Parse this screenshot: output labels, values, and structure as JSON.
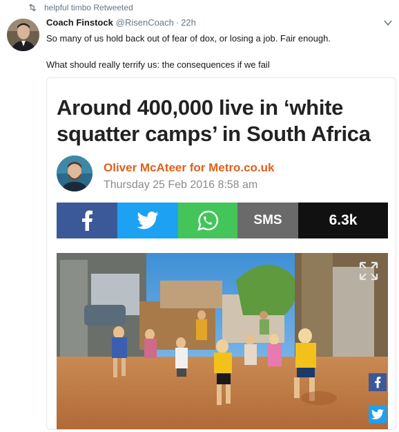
{
  "retweet": {
    "text": "helpful timbo Retweeted"
  },
  "tweet": {
    "name": "Coach Finstock",
    "handle": "@RisenCoach",
    "separator": "·",
    "time": "22h",
    "text": "So many of us hold back out of fear of dox, or losing a job. Fair enough.\n\nWhat should really terrify us: the consequences if we fail"
  },
  "card": {
    "headline": "Around 400,000 live in ‘white squatter camps’ in South Africa",
    "author": "Oliver McAteer for Metro.co.uk",
    "date": "Thursday 25 Feb 2016 8:58 am",
    "share": {
      "sms_label": "SMS",
      "count": "6.3k"
    }
  },
  "colors": {
    "facebook": "#3b5998",
    "twitter": "#1da1f2",
    "whatsapp": "#43c55a",
    "sms": "#6a6a6a",
    "count_bg": "#111111",
    "author": "#e0601a"
  },
  "icons": [
    "retweet-icon",
    "caret-down-icon",
    "facebook-icon",
    "twitter-icon",
    "whatsapp-icon",
    "expand-icon"
  ]
}
